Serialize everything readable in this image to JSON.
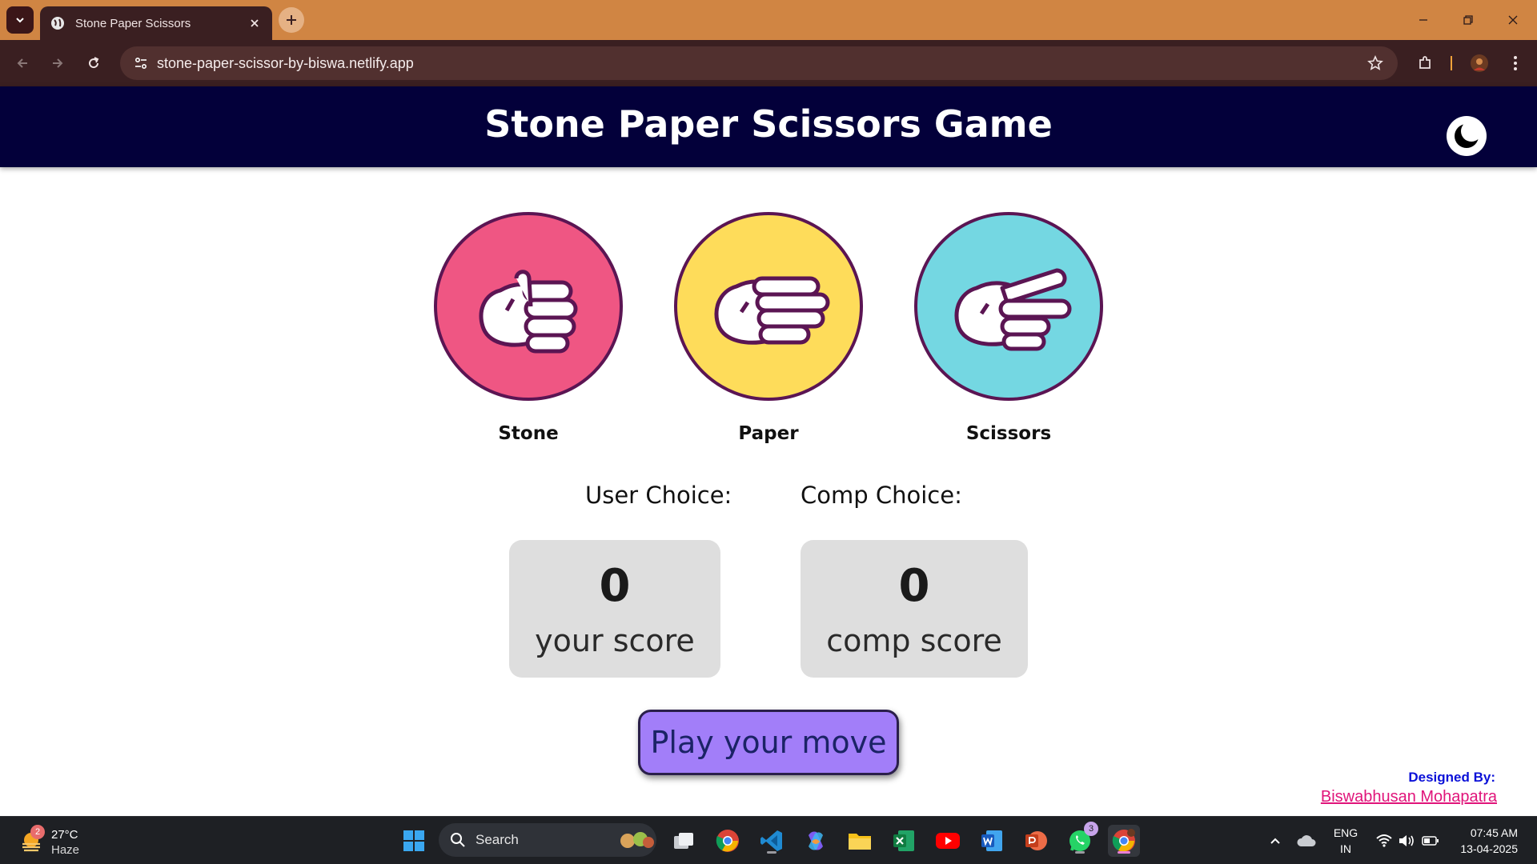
{
  "browser": {
    "tab_title": "Stone Paper Scissors",
    "url": "stone-paper-scissor-by-biswa.netlify.app"
  },
  "page": {
    "title": "Stone Paper Scissors Game",
    "choices": [
      {
        "label": "Stone",
        "color": "#ef5683"
      },
      {
        "label": "Paper",
        "color": "#fedc5a"
      },
      {
        "label": "Scissors",
        "color": "#74d7e2"
      }
    ],
    "user_choice_label": "User Choice:",
    "comp_choice_label": "Comp Choice:",
    "user_score": "0",
    "user_score_label": "your score",
    "comp_score": "0",
    "comp_score_label": "comp score",
    "play_button": "Play your move",
    "credit_title": "Designed By:",
    "credit_name": "Biswabhusan Mohapatra"
  },
  "taskbar": {
    "weather_badge": "2",
    "weather_temp": "27°C",
    "weather_condition": "Haze",
    "search_label": "Search",
    "whatsapp_badge": "3",
    "lang_line1": "ENG",
    "lang_line2": "IN",
    "time": "07:45 AM",
    "date": "13-04-2025"
  },
  "colors": {
    "header_bg": "#03003a",
    "button_bg": "#a27ef9",
    "credit_link": "#e0147a",
    "accent_outline": "#5b1553"
  }
}
